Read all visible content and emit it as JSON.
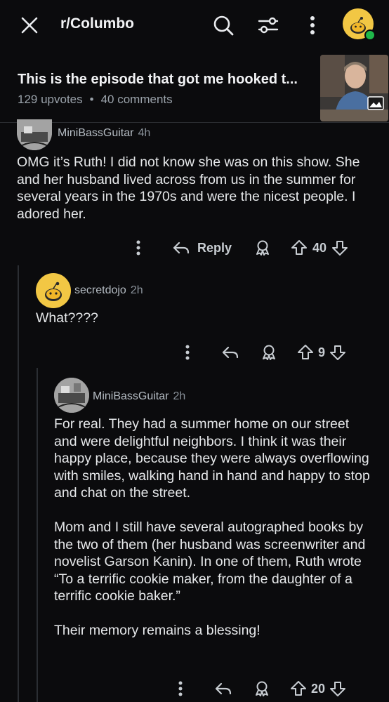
{
  "topbar": {
    "subreddit": "r/Columbo",
    "icons": [
      "close-icon",
      "search-icon",
      "filter-icon",
      "more-vertical-icon",
      "user-avatar"
    ]
  },
  "post": {
    "title": "This is the episode that got me hooked t...",
    "upvotes": "129 upvotes",
    "comments": "40 comments"
  },
  "comments": [
    {
      "author": "MiniBassGuitar",
      "time": "4h",
      "body": "OMG it’s Ruth! I did not know she was on this show. She and her husband lived across from us in the summer for several years in the 1970s and were the nicest people. I adored her.",
      "reply_label": "Reply",
      "score": "40"
    },
    {
      "author": "secretdojo",
      "time": "2h",
      "body": "What????",
      "score": "9"
    },
    {
      "author": "MiniBassGuitar",
      "time": "2h",
      "body_paragraphs": [
        "For real. They had a summer home on our street and were delightful neighbors. I think it was their happy place, because they were always overflowing with smiles, walking hand in hand and happy to stop and chat on the street.",
        "Mom and I still have several autographed books by the two of them (her husband was screenwriter and novelist Garson Kanin). In one of them, Ruth wrote “To a terrific cookie maker, from the daughter of a terrific cookie baker.”",
        "Their memory remains a blessing!"
      ],
      "score": "20"
    }
  ],
  "colors": {
    "background": "#0b0b0d",
    "snoo_yellow": "#f2c744",
    "online_green": "#1fb84a"
  }
}
